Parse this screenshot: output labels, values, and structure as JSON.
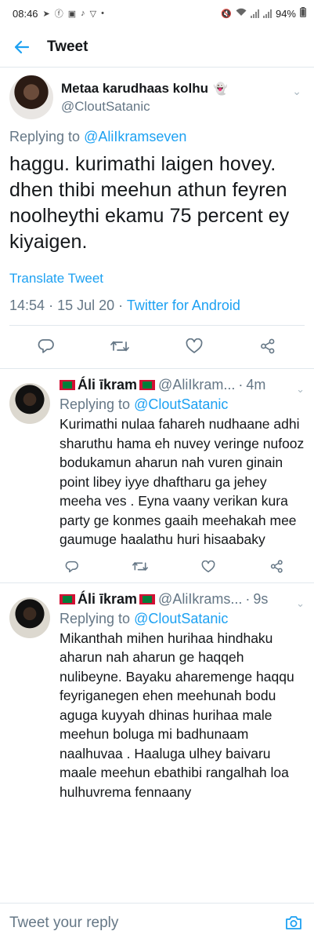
{
  "status_bar": {
    "time": "08:46",
    "battery": "94%"
  },
  "appbar": {
    "title": "Tweet"
  },
  "main_tweet": {
    "name": "Metaa karudhaas kolhu",
    "name_emoji": "👻",
    "handle": "@CloutSatanic",
    "replying_prefix": "Replying to",
    "replying_to": "@AliIkramseven",
    "text": "haggu. kurimathi laigen hovey. dhen thibi meehun athun feyren noolheythi ekamu 75 percent ey kiyaigen.",
    "translate": "Translate Tweet",
    "time": "14:54",
    "date": "15 Jul 20",
    "separator": "·",
    "client": "Twitter for Android"
  },
  "replies": [
    {
      "name": "Áli īkram",
      "handle": "@AliIkram...",
      "time": "4m",
      "separator": "·",
      "replying_prefix": "Replying to",
      "replying_to": "@CloutSatanic",
      "text": "Kurimathi nulaa fahareh nudhaane adhi sharuthu hama eh nuvey veringe nufooz bodukamun aharun nah vuren ginain point libey iyye dhaftharu ga jehey meeha ves . Eyna vaany verikan kura party ge konmes gaaih meehakah mee gaumuge haalathu huri hisaabaky"
    },
    {
      "name": "Áli īkram",
      "handle": "@AliIkrams...",
      "time": "9s",
      "separator": "·",
      "replying_prefix": "Replying to",
      "replying_to": "@CloutSatanic",
      "text": "Mikanthah mihen hurihaa hindhaku aharun nah aharun ge haqqeh nulibeyne. Bayaku aharemenge haqqu feyriganegen ehen meehunah bodu aguga kuyyah dhinas hurihaa male meehun boluga mi badhunaam naalhuvaa . Haaluga ulhey baivaru maale meehun ebathibi rangalhah loa hulhuvrema fennaany"
    }
  ],
  "composer": {
    "placeholder": "Tweet your reply"
  },
  "colors": {
    "accent": "#1da1f2",
    "secondary_text": "#657786",
    "divider": "#e1e8ed"
  }
}
